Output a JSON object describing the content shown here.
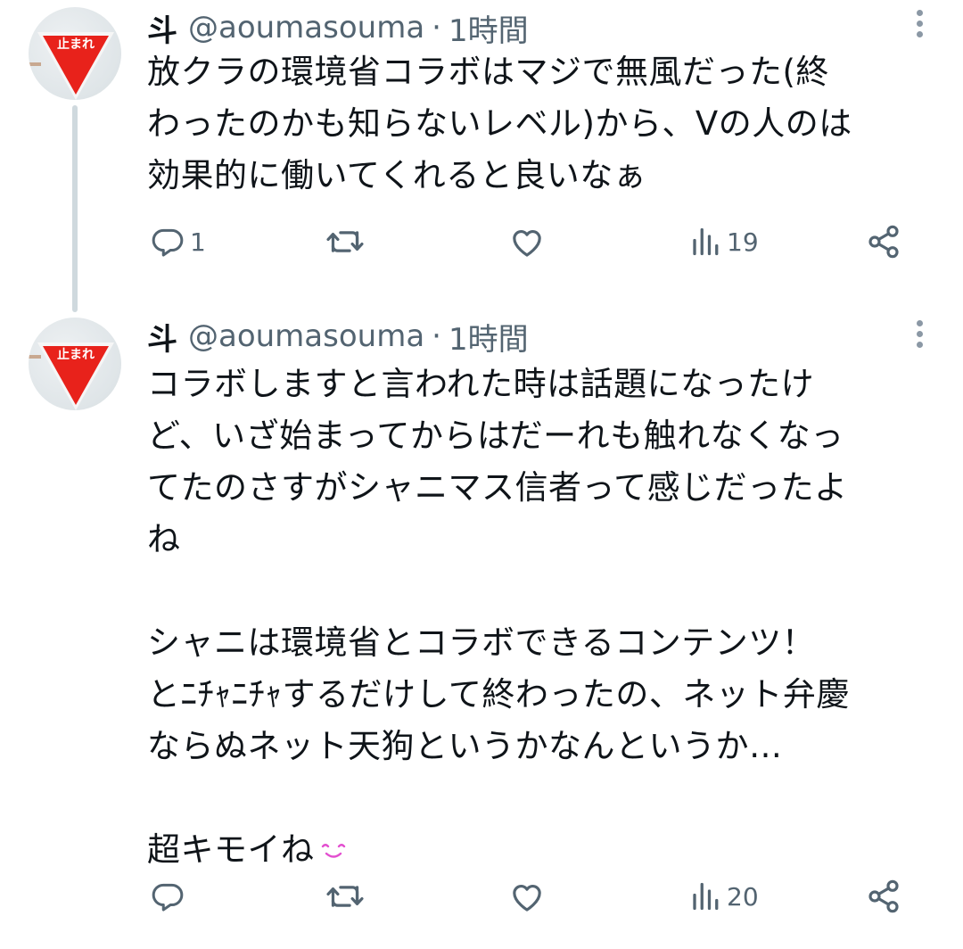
{
  "tweets": [
    {
      "name": "斗",
      "handle": "@aoumasouma",
      "separator": "·",
      "time": "1時間",
      "avatar_sign_text": "止まれ",
      "text": "放クラの環境省コラボはマジで無風だった(終\nわったのかも知らないレベル)から、Vの人のは\n効果的に働いてくれると良いなぁ",
      "stats": {
        "replies": "1",
        "retweets": "",
        "likes": "",
        "views": "19"
      }
    },
    {
      "name": "斗",
      "handle": "@aoumasouma",
      "separator": "·",
      "time": "1時間",
      "avatar_sign_text": "止まれ",
      "text": "コラボしますと言われた時は話題になったけ\nど、いざ始まってからはだーれも触れなくなっ\nてたのさすがシャニマス信者って感じだったよ\nね\n\nシャニは環境省とコラボできるコンテンツ！\nとﾆﾁｬﾆﾁｬするだけして終わったの、ネット弁慶\nならぬネット天狗というかなんというか…\n\n超キモイね",
      "emoji": "smiling-face-emoji",
      "stats": {
        "replies": "",
        "retweets": "",
        "likes": "",
        "views": "20"
      }
    }
  ],
  "colors": {
    "text": "#0f1419",
    "secondary": "#536471",
    "thread_line": "#cfd9de",
    "sign_red": "#e8221b",
    "emoji_pink": "#e34fd0"
  },
  "icons": [
    "reply-icon",
    "retweet-icon",
    "like-icon",
    "views-icon",
    "share-icon",
    "more-icon"
  ]
}
